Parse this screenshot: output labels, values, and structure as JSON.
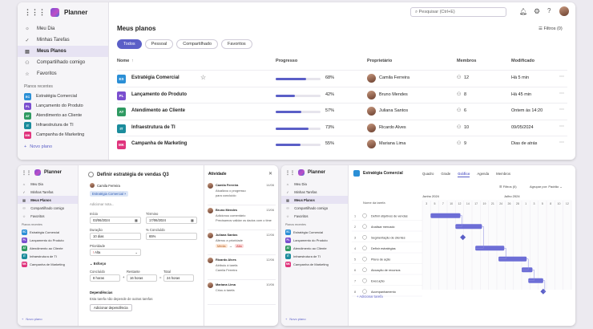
{
  "app_name": "Planner",
  "top": {
    "search_placeholder": "Pesquisar (Ctrl+E)",
    "nav": [
      "Meu Dia",
      "Minhas Tarefas",
      "Meus Planos",
      "Compartilhado comigo",
      "Favoritos"
    ],
    "recent_title": "Planos recentes",
    "plans": [
      {
        "abbr": "EC",
        "name": "Estratégia Comercial",
        "color": "#2b8fd6"
      },
      {
        "abbr": "PL",
        "name": "Lançamento do Produto",
        "color": "#7a4fcf"
      },
      {
        "abbr": "AT",
        "name": "Atendimento ao Cliente",
        "color": "#2f9a62"
      },
      {
        "abbr": "IT",
        "name": "Infraestrutura de TI",
        "color": "#1b8c9c"
      },
      {
        "abbr": "MK",
        "name": "Campanha de Marketing",
        "color": "#e0337c"
      }
    ],
    "new_plan": "Novo plano",
    "title": "Meus planos",
    "filters": "Filtros (0)",
    "tabs": [
      "Todos",
      "Pessoal",
      "Compartilhado",
      "Favoritos"
    ],
    "columns": [
      "Nome",
      "Progresso",
      "Proprietário",
      "Membros",
      "Modificado"
    ],
    "rows": [
      {
        "abbr": "ES",
        "name": "Estratégia Comercial",
        "color": "#2b8fd6",
        "progress": 0.68,
        "pct": "68%",
        "owner": "Camila Ferreira",
        "members": "12",
        "modified": "Há 5 min"
      },
      {
        "abbr": "PL",
        "name": "Lançamento do Produto",
        "color": "#7a4fcf",
        "progress": 0.42,
        "pct": "42%",
        "owner": "Bruno Mendes",
        "members": "8",
        "modified": "Há 45 min"
      },
      {
        "abbr": "AT",
        "name": "Atendimento ao Cliente",
        "color": "#2f9a62",
        "progress": 0.57,
        "pct": "57%",
        "owner": "Juliana Santos",
        "members": "6",
        "modified": "Ontem às 14:20"
      },
      {
        "abbr": "IT",
        "name": "Infraestrutura de TI",
        "color": "#1b8c9c",
        "progress": 0.73,
        "pct": "73%",
        "owner": "Ricardo Alves",
        "members": "10",
        "modified": "09/05/2024"
      },
      {
        "abbr": "MK",
        "name": "Campanha de Marketing",
        "color": "#e0337c",
        "progress": 0.55,
        "pct": "55%",
        "owner": "Mariana Lima",
        "members": "9",
        "modified": "Dias de atrás"
      }
    ]
  },
  "task": {
    "title": "Definir estratégia de vendas Q3",
    "assignee": "Camila Ferreira",
    "bucket": "Estratégia Comercial",
    "add_note": "Adicionar nota...",
    "start_label": "Início",
    "start": "03/06/2024",
    "due_label": "Término",
    "due": "17/06/2024",
    "duration_label": "Duração",
    "duration": "10 dias",
    "pct_label": "% Concluído",
    "pct": "65%",
    "priority_label": "Prioridade",
    "priority": "Alta",
    "effort": "Esforço",
    "done_label": "Concluído",
    "done": "8 horas",
    "remaining_label": "Restante",
    "remaining": "16 horas",
    "total_label": "Total",
    "total": "24 horas",
    "deps_label": "Dependências",
    "deps_text": "Esta tarefa não depende de outras tarefas",
    "add_dep": "Adicionar dependência"
  },
  "activity": {
    "title": "Atividade",
    "items": [
      {
        "who": "Camila Ferreira",
        "date": "14/06",
        "l1": "Atualizou o progresso",
        "l2": "para concluído"
      },
      {
        "who": "Bruno Mendes",
        "date": "13/06",
        "l1": "Adicionou comentário",
        "l2": "Precisamos validar os dados com o time"
      },
      {
        "who": "Juliana Santos",
        "date": "12/06",
        "l1": "Alterou a prioridade",
        "l2": "",
        "chip1": "Média",
        "chip2": "Alta"
      },
      {
        "who": "Ricardo Alves",
        "date": "12/06",
        "l1": "Atribuiu à tarefa",
        "l2": "Camila Ferreira"
      },
      {
        "who": "Mariana Lima",
        "date": "10/06",
        "l1": "Criou a tarefa",
        "l2": ""
      }
    ]
  },
  "timeline": {
    "plan": "Estratégia Comercial",
    "tabs": [
      "Quadro",
      "Grade",
      "Gráfico",
      "Agenda",
      "Membros"
    ],
    "active_tab": "Gráfico",
    "filters": "Filtros (0)",
    "group": "Agrupar por: Padrão",
    "task_col": "Nome da tarefa",
    "month1": "Junho 2024",
    "month2": "Julho 2024",
    "days": [
      "3",
      "5",
      "7",
      "10",
      "12",
      "14",
      "17",
      "19",
      "21",
      "24",
      "26",
      "28",
      "1",
      "3",
      "5",
      "8",
      "10",
      "12"
    ],
    "tasks": [
      {
        "n": "1",
        "name": "Definir objetivos de vendas",
        "start": 1,
        "end": 4.6
      },
      {
        "n": "2",
        "name": "Analisar mercado",
        "start": 4,
        "end": 7.2
      },
      {
        "n": "3",
        "name": "Segmentação de clientes",
        "start": 4.9,
        "end": 4.9
      },
      {
        "n": "4",
        "name": "Definir estratégias",
        "start": 6.4,
        "end": 9.9
      },
      {
        "n": "5",
        "name": "Plano de ação",
        "start": 9.2,
        "end": 12.6
      },
      {
        "n": "6",
        "name": "Alocação de recursos",
        "start": 12,
        "end": 13.3
      },
      {
        "n": "7",
        "name": "Execução",
        "start": 12.8,
        "end": 14.6
      },
      {
        "n": "8",
        "name": "Acompanhamento",
        "start": 14.6,
        "end": 14.6
      }
    ],
    "add_task": "Adicionar tarefa"
  }
}
